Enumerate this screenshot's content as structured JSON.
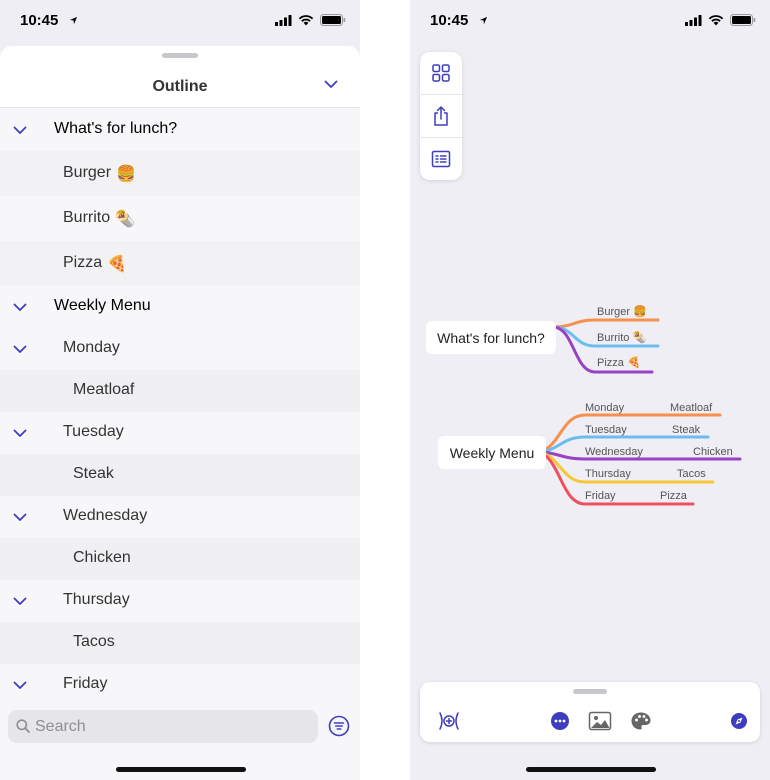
{
  "status": {
    "time": "10:45"
  },
  "left": {
    "title": "Outline",
    "groups": [
      {
        "label": "What's for lunch?",
        "children": [
          {
            "label": "Burger",
            "emoji": "🍔"
          },
          {
            "label": "Burrito",
            "emoji": "🌯"
          },
          {
            "label": "Pizza",
            "emoji": "🍕"
          }
        ]
      },
      {
        "label": "Weekly Menu",
        "children": [
          {
            "label": "Monday",
            "sub": "Meatloaf"
          },
          {
            "label": "Tuesday",
            "sub": "Steak"
          },
          {
            "label": "Wednesday",
            "sub": "Chicken"
          },
          {
            "label": "Thursday",
            "sub": "Tacos"
          },
          {
            "label": "Friday"
          }
        ]
      }
    ],
    "search": {
      "placeholder": "Search",
      "value": ""
    }
  },
  "right": {
    "map": {
      "lunch": {
        "label": "What's for lunch?",
        "children": [
          "Burger 🍔",
          "Burrito 🌯",
          "Pizza 🍕"
        ]
      },
      "weekly": {
        "label": "Weekly Menu",
        "days": [
          {
            "day": "Monday",
            "item": "Meatloaf"
          },
          {
            "day": "Tuesday",
            "item": "Steak"
          },
          {
            "day": "Wednesday",
            "item": "Chicken"
          },
          {
            "day": "Thursday",
            "item": "Tacos"
          },
          {
            "day": "Friday",
            "item": "Pizza"
          }
        ]
      }
    }
  },
  "colors": {
    "accent": "#3f3dbf",
    "orange": "#f5904d",
    "blue": "#6cbcf0",
    "purple": "#9a42c4",
    "yellow": "#f7c738",
    "red": "#ef5060"
  },
  "icons": {
    "status": [
      "location-arrow-icon",
      "signal-icon",
      "wifi-icon",
      "battery-icon"
    ],
    "left": [
      "chevron-down-icon",
      "search-icon",
      "filter-icon"
    ],
    "right_toolbar": [
      "grid-icon",
      "share-icon",
      "outline-list-icon"
    ],
    "right_bottom": [
      "add-node-icon",
      "more-icon",
      "image-icon",
      "palette-icon",
      "compass-icon"
    ]
  }
}
